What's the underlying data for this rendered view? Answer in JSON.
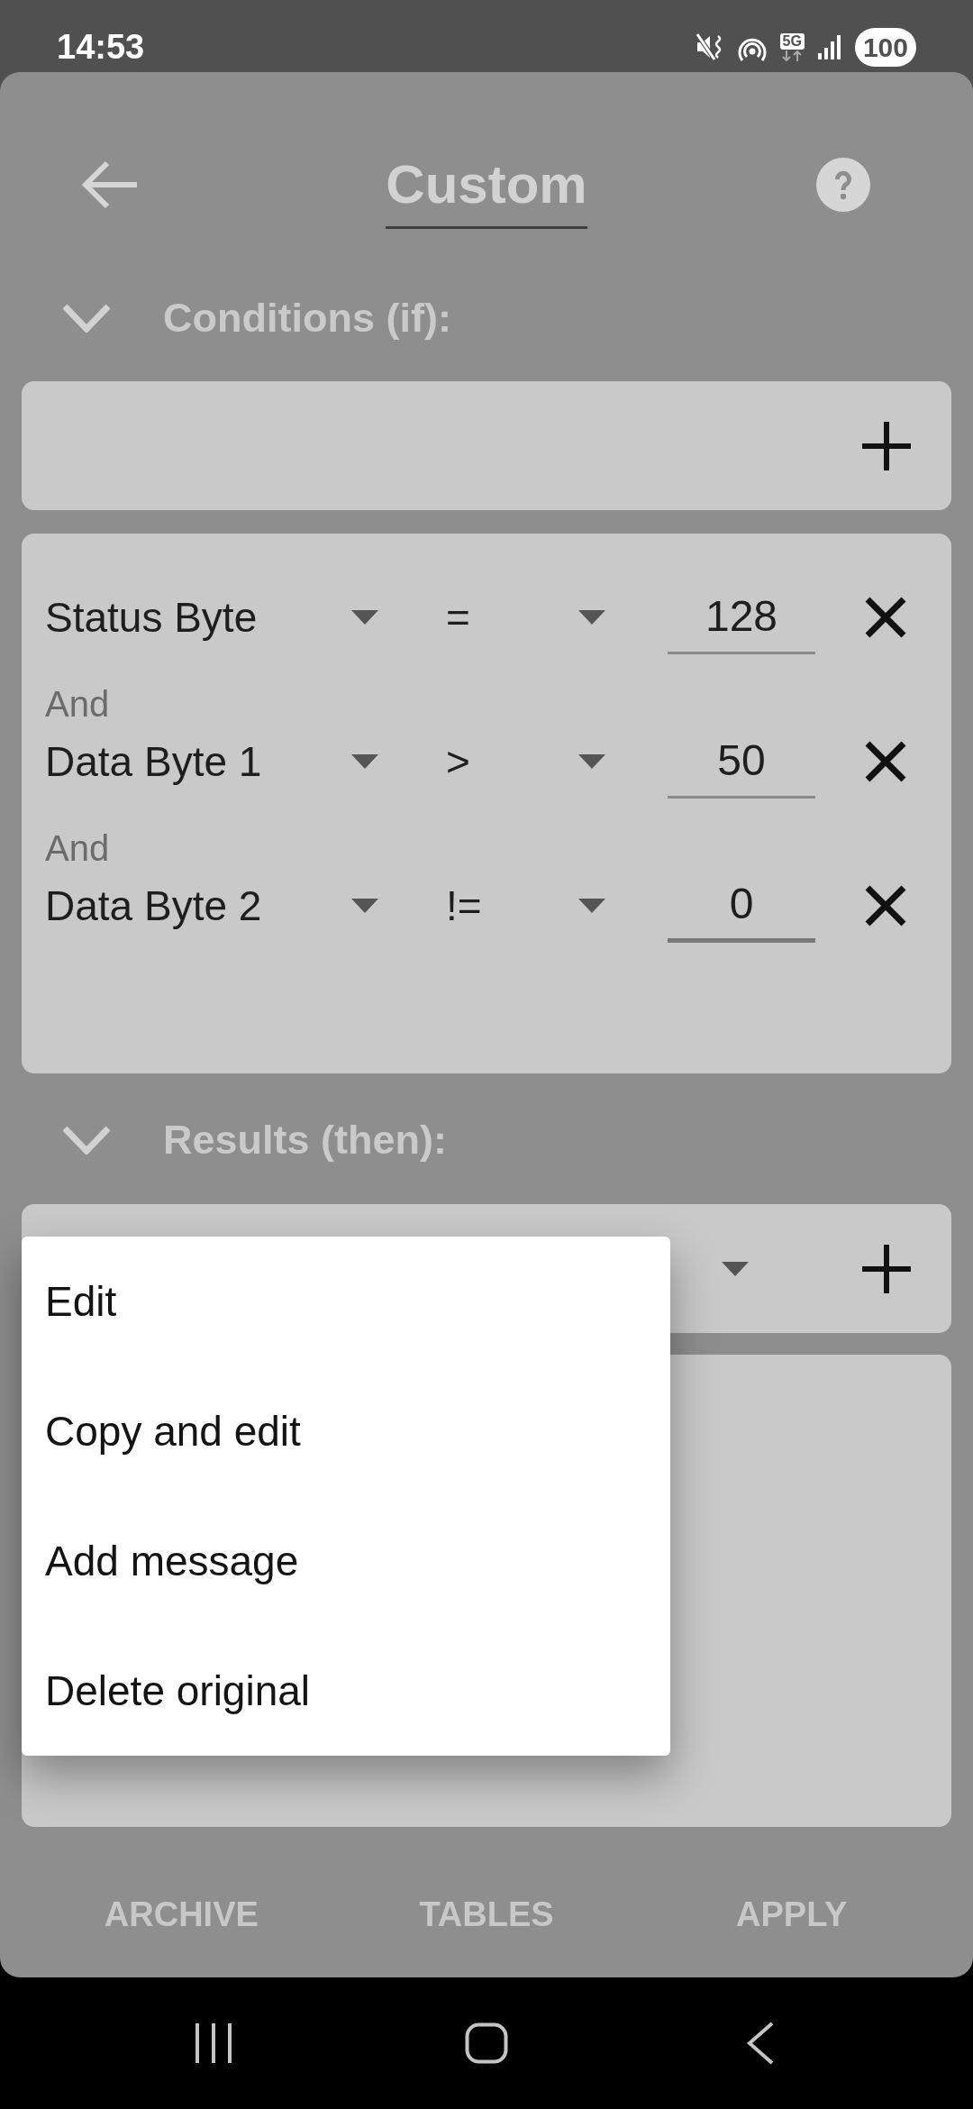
{
  "status_bar": {
    "time": "14:53",
    "network": "5G",
    "battery": "100"
  },
  "header": {
    "title": "Custom"
  },
  "conditions": {
    "heading": "Conditions (if):",
    "expanded": true,
    "rows": [
      {
        "field": "Status Byte",
        "operator": "=",
        "value": "128",
        "focused": false
      },
      {
        "connector": "And",
        "field": "Data Byte 1",
        "operator": ">",
        "value": "50",
        "focused": false
      },
      {
        "connector": "And",
        "field": "Data Byte 2",
        "operator": "!=",
        "value": "0",
        "focused": true
      }
    ]
  },
  "results": {
    "heading": "Results (then):",
    "expanded": true
  },
  "context_menu": {
    "items": [
      "Edit",
      "Copy and edit",
      "Add message",
      "Delete original"
    ]
  },
  "buttons": [
    "ARCHIVE",
    "TABLES",
    "APPLY"
  ]
}
